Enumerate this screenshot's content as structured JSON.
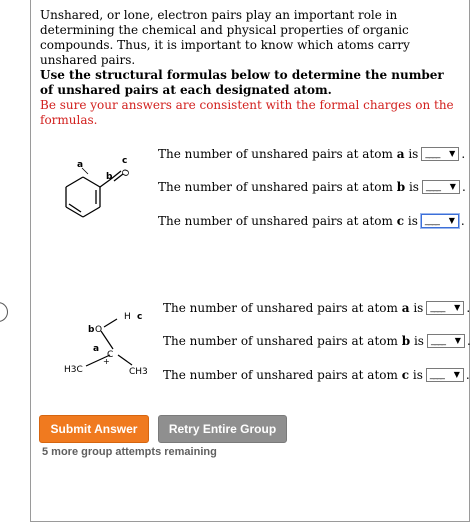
{
  "intro": {
    "paragraph": "Unshared, or lone, electron pairs play an important role in determining the chemical and physical properties of organic compounds. Thus, it is important to know which atoms carry unshared pairs.",
    "instruction": "Use the structural formulas below to determine the number of unshared pairs at each designated atom.",
    "warning": "Be sure your answers are consistent with the formal charges on the formulas."
  },
  "question_prefix": "The number of unshared pairs at atom",
  "question_connector": "is",
  "select_placeholder": "____",
  "period": ".",
  "molecule1": {
    "label_a": "a",
    "label_b": "b",
    "label_c": "c",
    "atom_o": "O",
    "questions": [
      {
        "atom": "a",
        "value": "____"
      },
      {
        "atom": "b",
        "value": "____"
      },
      {
        "atom": "c",
        "value": "____"
      }
    ]
  },
  "molecule2": {
    "label_a": "a",
    "label_b": "b",
    "label_c": "c",
    "atom_h": "H",
    "atom_o": "O",
    "atom_c": "C",
    "charge": "+",
    "ch3_left": "H3C",
    "ch3_right": "CH3",
    "questions": [
      {
        "atom": "a",
        "value": "____"
      },
      {
        "atom": "b",
        "value": "____"
      },
      {
        "atom": "c",
        "value": "____"
      }
    ]
  },
  "buttons": {
    "submit_label": "Submit Answer",
    "retry_label": "Retry Entire Group"
  },
  "attempts_text": "5 more group attempts remaining",
  "colors": {
    "warning_red": "#d2201e",
    "submit_orange": "#f07a1f",
    "retry_gray": "#8f8f8f",
    "focus_blue": "#3c6fd8"
  }
}
